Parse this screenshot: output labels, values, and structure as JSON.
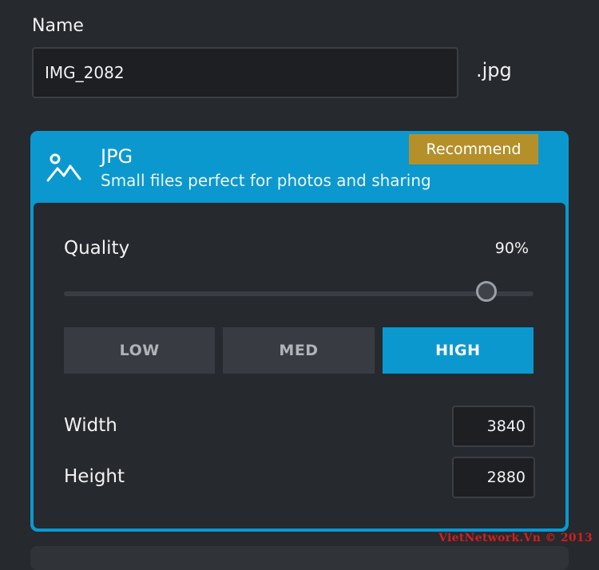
{
  "name_section": {
    "label": "Name",
    "filename": "IMG_2082",
    "extension": ".jpg"
  },
  "format_card": {
    "icon": "image-icon",
    "title": "JPG",
    "description": "Small files perfect for photos and sharing",
    "badge": "Recommend",
    "accent_color": "#0b98cf",
    "badge_color": "#b5902a"
  },
  "quality": {
    "label": "Quality",
    "value_text": "90%",
    "value": 0.9
  },
  "presets": {
    "options": [
      "LOW",
      "MED",
      "HIGH"
    ],
    "selected": "HIGH"
  },
  "dimensions": {
    "width_label": "Width",
    "width_value": "3840",
    "height_label": "Height",
    "height_value": "2880"
  },
  "watermark": "VietNetwork.Vn © 2013"
}
